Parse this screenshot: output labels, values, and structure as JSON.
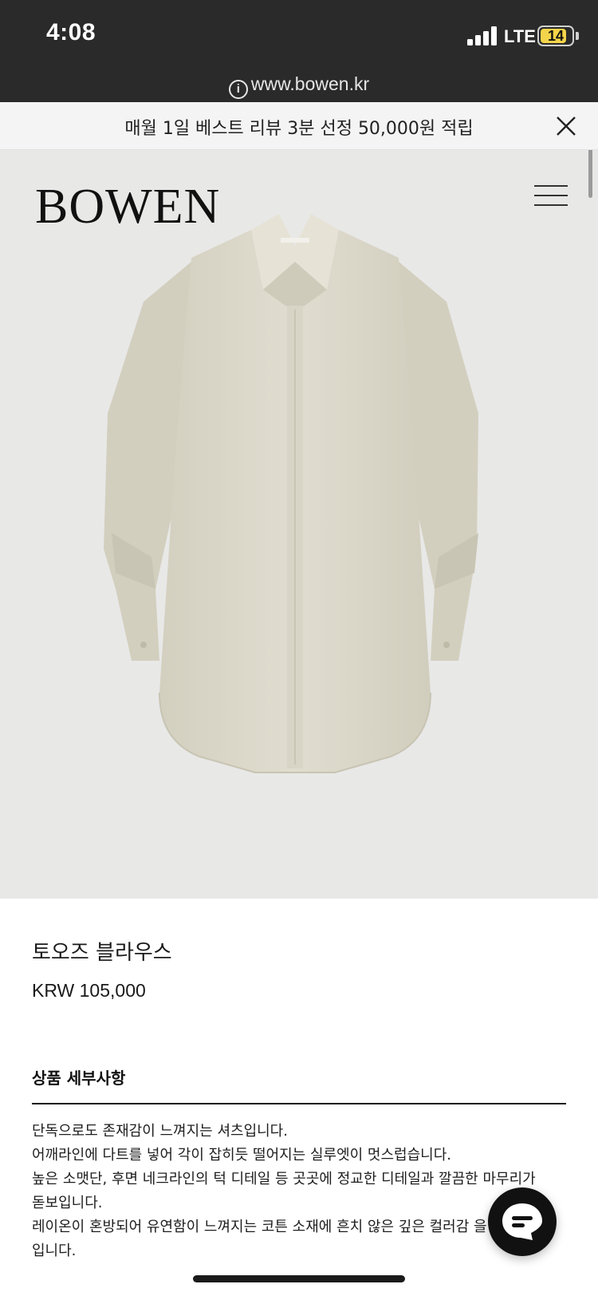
{
  "status_bar": {
    "time": "4:08",
    "network": "LTE",
    "battery": "14",
    "battery_level": 0.14
  },
  "browser": {
    "url": "www.bowen.kr"
  },
  "promo_banner": {
    "text": "매월 1일 베스트 리뷰 3분 선정 50,000원 적립"
  },
  "header": {
    "brand": "BOWEN"
  },
  "product": {
    "name": "토오즈 블라우스",
    "price": "KRW 105,000",
    "image_color": "#dcd8c9"
  },
  "details": {
    "heading": "상품 세부사항",
    "lines": [
      "단독으로도 존재감이 느껴지는 셔츠입니다.",
      "어깨라인에 다트를 넣어 각이 잡히듯 떨어지는 실루엣이 멋스럽습니다.",
      "높은 소맷단, 후면 네크라인의 턱 디테일 등 곳곳에 정교한 디테일과 깔끔한 마무리가",
      "돋보입니다.",
      "레이온이 혼방되어 유연함이 느껴지는 코튼 소재에 흔치 않은 깊은 컬러감 을 더해",
      "입니다."
    ]
  },
  "icons": {
    "info": "info-icon",
    "close": "close-icon",
    "menu": "hamburger-menu-icon",
    "chat": "chat-bubble-icon"
  }
}
